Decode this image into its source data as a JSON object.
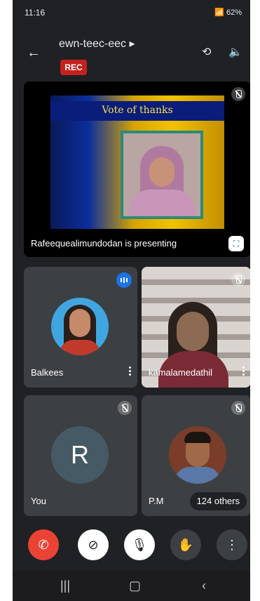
{
  "status": {
    "time": "11:16",
    "battery": "62%"
  },
  "meeting": {
    "title": "ewn-teec-eec",
    "rec_label": "REC"
  },
  "presentation": {
    "slide_title": "Vote of thanks",
    "presenter_label": "Rafeequealimundodan is presenting"
  },
  "participants": [
    {
      "name": "Balkees"
    },
    {
      "name": "kamalamedathil"
    },
    {
      "name": "You",
      "initial": "R"
    },
    {
      "name": "P.M"
    }
  ],
  "others_label": "124 others"
}
